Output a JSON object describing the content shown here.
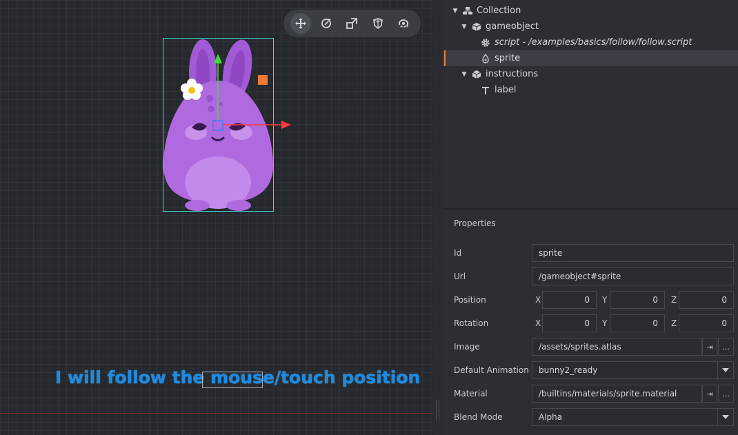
{
  "viewport": {
    "label_text": "I will follow the mouse/touch position",
    "toolbar": [
      {
        "name": "move-tool",
        "icon": "move-icon",
        "active": true
      },
      {
        "name": "rotate-tool",
        "icon": "rotate-icon",
        "active": false
      },
      {
        "name": "scale-tool",
        "icon": "scale-icon",
        "active": false
      },
      {
        "name": "visibility-filter-tool",
        "icon": "shield-icon",
        "active": false
      },
      {
        "name": "camera-tool",
        "icon": "camera-rotate-icon",
        "active": false
      }
    ],
    "colors": {
      "selection": "#3fd7d7",
      "x_axis": "#ff3b3b",
      "y_axis": "#3cdc3c",
      "handle": "#f07a34",
      "label": "#1a8be6"
    }
  },
  "outline": {
    "items": [
      {
        "label": "Collection",
        "icon": "collection-icon",
        "expanded": true,
        "depth": 0
      },
      {
        "label": "gameobject",
        "icon": "cube-icon",
        "expanded": true,
        "depth": 1
      },
      {
        "label": "script - /examples/basics/follow/follow.script",
        "icon": "gear-icon",
        "depth": 2,
        "italic": true
      },
      {
        "label": "sprite",
        "icon": "sprite-icon",
        "depth": 2,
        "selected": true
      },
      {
        "label": "instructions",
        "icon": "cube-icon",
        "expanded": true,
        "depth": 1
      },
      {
        "label": "label",
        "icon": "text-icon",
        "depth": 2
      }
    ]
  },
  "properties": {
    "title": "Properties",
    "id": {
      "label": "Id",
      "value": "sprite"
    },
    "url": {
      "label": "Url",
      "value": "/gameobject#sprite"
    },
    "position": {
      "label": "Position",
      "x": "0",
      "y": "0",
      "z": "0"
    },
    "rotation": {
      "label": "Rotation",
      "x": "0",
      "y": "0",
      "z": "0"
    },
    "axis_labels": {
      "x": "X",
      "y": "Y",
      "z": "Z"
    },
    "image": {
      "label": "Image",
      "value": "/assets/sprites.atlas"
    },
    "default_animation": {
      "label": "Default Animation",
      "value": "bunny2_ready"
    },
    "material": {
      "label": "Material",
      "value": "/builtins/materials/sprite.material"
    },
    "blend_mode": {
      "label": "Blend Mode",
      "value": "Alpha"
    },
    "goto_glyph": "⇥",
    "browse_glyph": "…"
  }
}
